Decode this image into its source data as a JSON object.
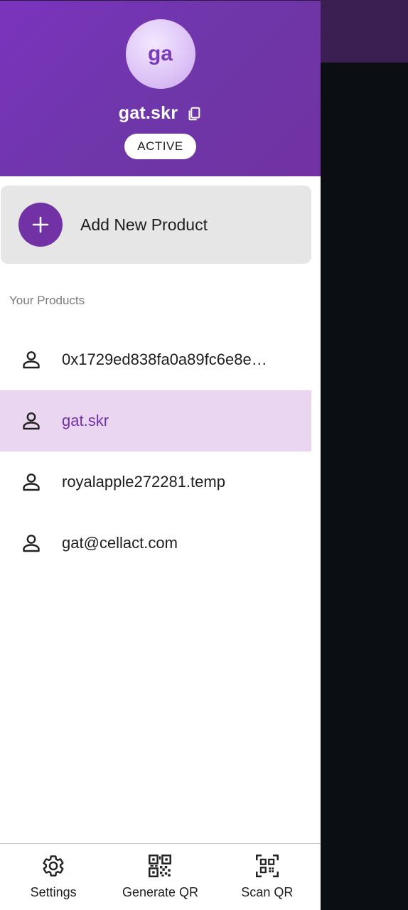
{
  "header": {
    "avatar_initials": "ga",
    "account_name": "gat.skr",
    "status": "ACTIVE"
  },
  "add_product": {
    "label": "Add New Product"
  },
  "products_section": {
    "title": "Your Products",
    "items": [
      {
        "label": "0x1729ed838fa0a89fc6e8e…",
        "selected": false
      },
      {
        "label": "gat.skr",
        "selected": true
      },
      {
        "label": "royalapple272281.temp",
        "selected": false
      },
      {
        "label": "gat@cellact.com",
        "selected": false
      }
    ]
  },
  "bottom_nav": {
    "settings_label": "Settings",
    "generate_qr_label": "Generate QR",
    "scan_qr_label": "Scan QR"
  },
  "colors": {
    "accent": "#7232a6",
    "selected_bg": "#ead6f0",
    "header_gradient_start": "#7a34bd",
    "scrim": "#0b0e12"
  },
  "icons": [
    "copy-icon",
    "plus-icon",
    "person-icon",
    "gear-icon",
    "qr-code-icon",
    "qr-scan-icon"
  ]
}
